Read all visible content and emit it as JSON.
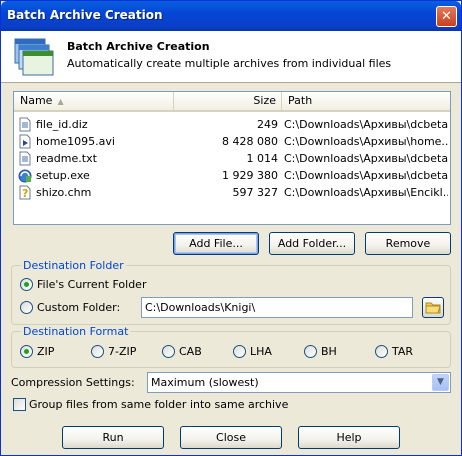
{
  "window": {
    "title": "Batch Archive Creation",
    "close_glyph": "✕"
  },
  "header": {
    "title": "Batch Archive Creation",
    "subtitle": "Automatically create multiple archives from individual files",
    "icon": "stacked-windows-icon"
  },
  "file_list": {
    "columns": {
      "name": "Name",
      "size": "Size",
      "path": "Path"
    },
    "sort_indicator": "▲",
    "rows": [
      {
        "name": "file_id.diz",
        "size": "249",
        "path": "C:\\Downloads\\Архивы\\dcbeta\\",
        "icon": "text-file-icon"
      },
      {
        "name": "home1095.avi",
        "size": "8 428 080",
        "path": "C:\\Downloads\\Архивы\\home...",
        "icon": "video-file-icon"
      },
      {
        "name": "readme.txt",
        "size": "1 014",
        "path": "C:\\Downloads\\Архивы\\dcbeta\\",
        "icon": "text-file-icon"
      },
      {
        "name": "setup.exe",
        "size": "1 929 380",
        "path": "C:\\Downloads\\Архивы\\dcbeta\\",
        "icon": "setup-file-icon"
      },
      {
        "name": "shizo.chm",
        "size": "597 327",
        "path": "C:\\Downloads\\Архивы\\Encikl...",
        "icon": "help-file-icon"
      }
    ]
  },
  "list_buttons": {
    "add_file": "Add File...",
    "add_folder": "Add Folder...",
    "remove": "Remove"
  },
  "destination_folder": {
    "legend": "Destination Folder",
    "current_label": "File's Current Folder",
    "custom_label": "Custom Folder:",
    "custom_value": "C:\\Downloads\\Knigi\\",
    "selected": "current"
  },
  "destination_format": {
    "legend": "Destination Format",
    "options": [
      "ZIP",
      "7-ZIP",
      "CAB",
      "LHA",
      "BH",
      "TAR"
    ],
    "selected": "ZIP"
  },
  "compression": {
    "label": "Compression Settings:",
    "value": "Maximum (slowest)"
  },
  "group_checkbox": {
    "label": "Group files from same folder into same archive",
    "checked": false
  },
  "footer_buttons": {
    "run": "Run",
    "close": "Close",
    "help": "Help"
  }
}
